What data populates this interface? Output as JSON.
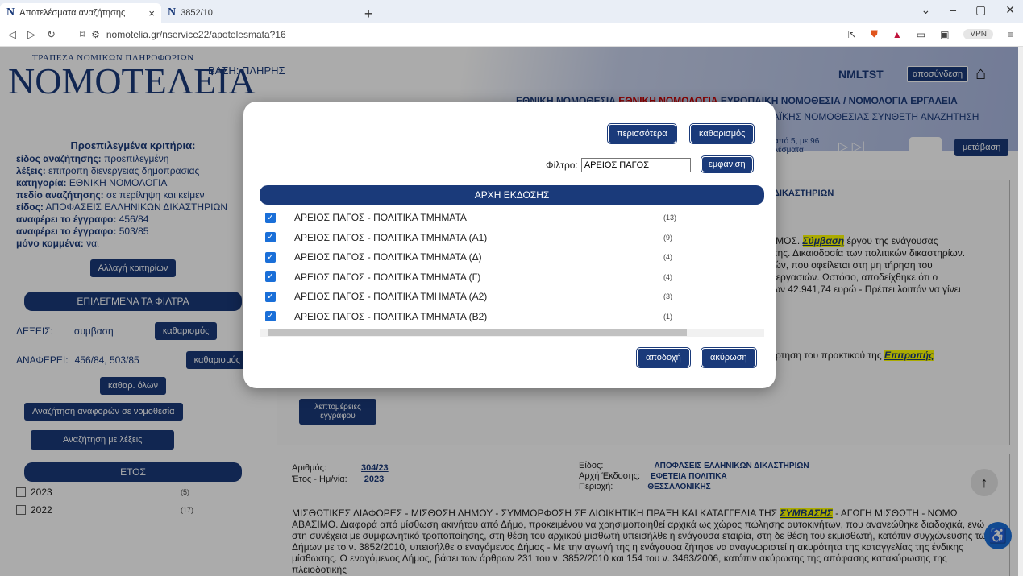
{
  "browser": {
    "tabs": [
      {
        "label": "Αποτελέσματα αναζήτησης",
        "active": true
      },
      {
        "label": "3852/10",
        "active": false
      }
    ],
    "url": "nomotelia.gr/nservice22/apotelesmata?16",
    "vpn": "VPN"
  },
  "header": {
    "logo_small": "ΤΡΑΠΕΖΑ ΝΟΜΙΚΩΝ ΠΛΗΡΟΦΟΡΙΩΝ",
    "logo_big": "NΟΜΟΤΕΛΕΙΑ",
    "vasi": "ΒΑΣΗ: ΠΛΗΡΗΣ",
    "user": "NMLTST",
    "logout": "αποσύνδεση",
    "nav_a": "ΕΘΝΙΚΗ ΝΟΜΟΘΕΣΙΑ",
    "nav_b": "ΕΘΝΙΚΗ ΝΟΜΟΛΟΓΙΑ",
    "nav_c": "ΕΥΡΩΠΑΙΚΗ ΝΟΜΟΘΕΣΙΑ / ΝΟΜΟΛΟΓΙΑ",
    "nav_d": "ΕΡΓΑΛΕΙΑ",
    "nav2": "ΠΑΪΚΗΣ ΝΟΜΟΘΕΣΙΑΣ  ΣΥΝΘΕΤΗ ΑΝΑΖΗΤΗΣΗ"
  },
  "left": {
    "title": "Προεπιλεγμένα κριτήρια:",
    "rows": [
      {
        "k": "είδος αναζήτησης:",
        "v": "προεπιλεγμένη"
      },
      {
        "k": "λέξεις:",
        "v": "επιτροπη διενεργειας δημοπρασιας"
      },
      {
        "k": "κατηγορία:",
        "v": "ΕΘΝΙΚΗ ΝΟΜΟΛΟΓΙΑ"
      },
      {
        "k": "πεδίο αναζήτησης:",
        "v": "σε περίληψη και κείμεν"
      },
      {
        "k": "είδος:",
        "v": "ΑΠΟΦΑΣΕΙΣ ΕΛΛΗΝΙΚΩΝ ΔΙΚΑΣΤΗΡΙΩΝ"
      },
      {
        "k": "αναφέρει το έγγραφο:",
        "v": "456/84"
      },
      {
        "k": "αναφέρει το έγγραφο:",
        "v": "503/85"
      },
      {
        "k": "μόνο κομμένα:",
        "v": "ναι"
      }
    ],
    "change_btn": "Αλλαγή κριτηρίων",
    "filters_bar": "ΕΠΙΛΕΓΜΕΝΑ ΤΑ ΦΙΛΤΡΑ",
    "f1_k": "ΛΕΞΕΙΣ:",
    "f1_v": "συμβαση",
    "f2_k": "ΑΝΑΦΕΡΕΙ:",
    "f2_v": "456/84, 503/85",
    "clear": "καθαρισμός",
    "clear_all": "καθαρ. όλων",
    "search_refs": "Αναζήτηση αναφορών σε νομοθεσία",
    "search_words": "Αναζήτηση με λέξεις",
    "year_bar": "ΕΤΟΣ",
    "years": [
      {
        "y": "2023",
        "c": "(5)"
      },
      {
        "y": "2022",
        "c": "(17)"
      }
    ]
  },
  "results": {
    "paging": "από 5, με 96 λέσματα",
    "goto": "μετάβαση",
    "d1_court": "ΔΙΚΑΣΤΗΡΙΩΝ",
    "d1_text1": "ΤΙΣΜΟΣ.",
    "d1_hl": "Σύμβαση",
    "d1_text2": "έργου της ενάγουσας",
    "d1_l2": "ής της. Δικαιοδοσία των πολιτικών δικαστηρίων.",
    "d1_l3": "εσιών, που οφείλεται στη μη τήρηση του",
    "d1_l4": "ων εργασιών. Ωστόσο, αποδείχθηκε ότι ο",
    "d1_l5": "ό των 42.941,74 ευρώ - Πρέπει λοιπόν να γίνει",
    "d1_l6": "νάρτηση του πρακτικού της",
    "d1_hl2": "Επιτροπής",
    "details": "λεπτομέρειες εγγράφου",
    "d2_num_k": "Αριθμός:",
    "d2_num_v": "304/23",
    "d2_year_k": "Έτος - Ημ/νία:",
    "d2_year_v": "2023",
    "d2_kind_k": "Είδος:",
    "d2_kind_v": "ΑΠΟΦΑΣΕΙΣ ΕΛΛΗΝΙΚΩΝ ΔΙΚΑΣΤΗΡΙΩΝ",
    "d2_arch_k": "Αρχή Έκδοσης:",
    "d2_arch_v": "ΕΦΕΤΕΙΑ ΠΟΛΙΤΙΚΑ",
    "d2_area_k": "Περιοχή:",
    "d2_area_v": "ΘΕΣΣΑΛΟΝΙΚΗΣ",
    "d2_text": "ΜΙΣΘΩΤΙΚΕΣ ΔΙΑΦΟΡΕΣ - ΜΙΣΘΩΣΗ ΔΗΜΟΥ - ΣΥΜΜΟΡΦΩΣΗ ΣΕ ΔΙΟΙΚΗΤΙΚΗ ΠΡΑΞΗ ΚΑΙ ΚΑΤΑΓΓΕΛΙΑ ΤΗΣ",
    "d2_hl": "ΣΥΜΒΑΣΗΣ",
    "d2_text2": "- ΑΓΩΓΗ ΜΙΣΘΩΤΗ - ΝΟΜΩ ΑΒΑΣΙΜΟ. Διαφορά από μίσθωση ακινήτου από Δήμο, προκειμένου να χρησιμοποιηθεί αρχικά ως χώρος πώλησης αυτοκινήτων, που ανανεώθηκε διαδοχικά, ενώ στη συνέχεια με συμφωνητικό τροποποίησης, στη θέση του αρχικού μισθωτή υπεισήλθε η ενάγουσα εταιρία, στη δε θέση του εκμισθωτή, κατόπιν συγχώνευσης των Δήμων με το ν. 3852/2010, υπεισήλθε ο εναγόμενος Δήμος - Με την αγωγή της η ενάγουσα ζήτησε να αναγνωριστεί η ακυρότητα της καταγγελίας της ένδικης μίσθωσης. Ο εναγόμενος Δήμος, βάσει των άρθρων 231 του ν. 3852/2010 και 154 του ν. 3463/2006, κατόπιν ακύρωσης της απόφασης κατακύρωσης της πλειοδοτικής"
  },
  "modal": {
    "more": "περισσότερα",
    "clear": "καθαρισμός",
    "filter_label": "Φίλτρο:",
    "filter_value": "ΑΡΕΙΟΣ ΠΑΓΟΣ",
    "show": "εμφάνιση",
    "column": "ΑΡΧΗ ΕΚΔΟΣΗΣ",
    "items": [
      {
        "label": "ΑΡΕΙΟΣ ΠΑΓΟΣ - ΠΟΛΙΤΙΚΑ ΤΜΗΜΑΤΑ",
        "count": "(13)"
      },
      {
        "label": "ΑΡΕΙΟΣ ΠΑΓΟΣ - ΠΟΛΙΤΙΚΑ ΤΜΗΜΑΤΑ (Α1)",
        "count": "(9)"
      },
      {
        "label": "ΑΡΕΙΟΣ ΠΑΓΟΣ - ΠΟΛΙΤΙΚΑ ΤΜΗΜΑΤΑ (Δ)",
        "count": "(4)"
      },
      {
        "label": "ΑΡΕΙΟΣ ΠΑΓΟΣ - ΠΟΛΙΤΙΚΑ ΤΜΗΜΑΤΑ (Γ)",
        "count": "(4)"
      },
      {
        "label": "ΑΡΕΙΟΣ ΠΑΓΟΣ - ΠΟΛΙΤΙΚΑ ΤΜΗΜΑΤΑ (Α2)",
        "count": "(3)"
      },
      {
        "label": "ΑΡΕΙΟΣ ΠΑΓΟΣ - ΠΟΛΙΤΙΚΑ ΤΜΗΜΑΤΑ (Β2)",
        "count": "(1)"
      }
    ],
    "accept": "αποδοχή",
    "cancel": "ακύρωση"
  }
}
